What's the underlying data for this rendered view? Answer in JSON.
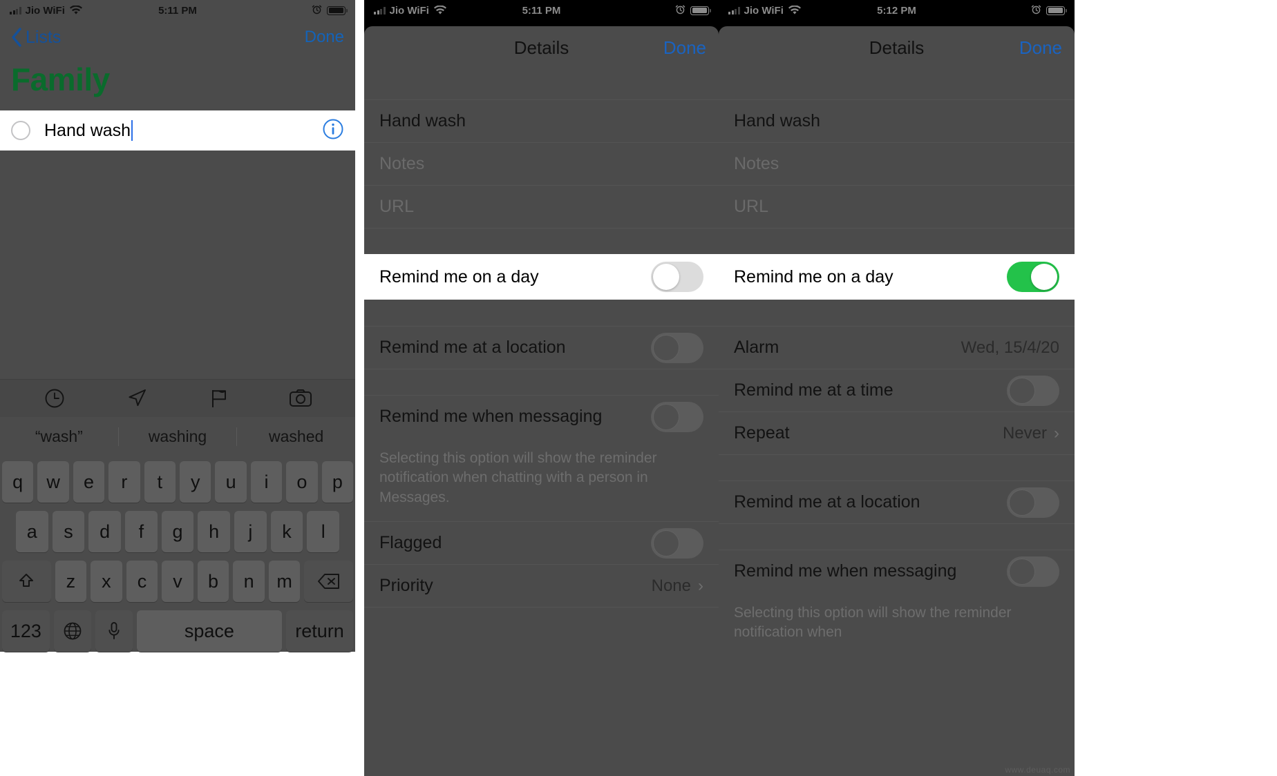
{
  "panel1": {
    "status": {
      "carrier": "Jio WiFi",
      "time": "5:11 PM"
    },
    "nav": {
      "back_label": "Lists",
      "done_label": "Done"
    },
    "list_title": "Family",
    "reminder": {
      "text": "Hand wash"
    },
    "keyboard": {
      "suggestions": [
        "“wash”",
        "washing",
        "washed"
      ],
      "row1": [
        "q",
        "w",
        "e",
        "r",
        "t",
        "y",
        "u",
        "i",
        "o",
        "p"
      ],
      "row2": [
        "a",
        "s",
        "d",
        "f",
        "g",
        "h",
        "j",
        "k",
        "l"
      ],
      "row3": [
        "z",
        "x",
        "c",
        "v",
        "b",
        "n",
        "m"
      ],
      "num_label": "123",
      "space_label": "space",
      "return_label": "return"
    }
  },
  "panel2": {
    "status": {
      "carrier": "Jio WiFi",
      "time": "5:11 PM"
    },
    "nav": {
      "title": "Details",
      "done_label": "Done"
    },
    "fields": {
      "title_value": "Hand wash",
      "notes_placeholder": "Notes",
      "url_placeholder": "URL"
    },
    "rows": [
      {
        "label": "Remind me on a day",
        "toggle": "off",
        "active": true
      },
      {
        "label": "Remind me at a location",
        "toggle": "off",
        "active": false
      },
      {
        "label": "Remind me when messaging",
        "toggle": "off",
        "active": false
      }
    ],
    "messaging_note": "Selecting this option will show the reminder notification when chatting with a person in Messages.",
    "flagged": {
      "label": "Flagged",
      "toggle": "off"
    },
    "priority": {
      "label": "Priority",
      "value": "None",
      "chevron": "›"
    }
  },
  "panel3": {
    "status": {
      "carrier": "Jio WiFi",
      "time": "5:12 PM"
    },
    "nav": {
      "title": "Details",
      "done_label": "Done"
    },
    "fields": {
      "title_value": "Hand wash",
      "notes_placeholder": "Notes",
      "url_placeholder": "URL"
    },
    "remind_day": {
      "label": "Remind me on a day",
      "toggle": "on"
    },
    "alarm": {
      "label": "Alarm",
      "value": "Wed, 15/4/20"
    },
    "remind_time": {
      "label": "Remind me at a time",
      "toggle": "off"
    },
    "repeat": {
      "label": "Repeat",
      "value": "Never",
      "chevron": "›"
    },
    "remind_location": {
      "label": "Remind me at a location",
      "toggle": "off"
    },
    "remind_messaging": {
      "label": "Remind me when messaging",
      "toggle": "off"
    },
    "messaging_note": "Selecting this option will show the reminder notification when"
  },
  "watermark": "www.deuaq.com",
  "colors": {
    "accent_blue": "#1463b8",
    "list_green": "#0a6b2c",
    "toggle_on_green": "#23c24a",
    "dim_overlay": "#4b4b4b"
  }
}
